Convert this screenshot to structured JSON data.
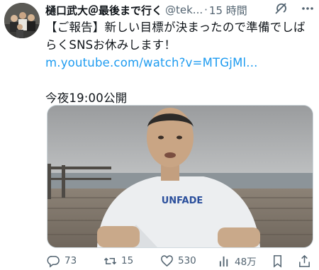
{
  "author": {
    "name": "樋口武大＠最後まで行く",
    "handle": "@tek...",
    "separator": "·",
    "time": "15 時間"
  },
  "tweet": {
    "line1": "【ご報告】新しい目標が決まったので準備でしば",
    "line2": "らくSNSお休みします！",
    "link": "m.youtube.com/watch?v=MTGjMl...",
    "line4": "今夜19:00公開"
  },
  "media": {
    "shirt_text": "UNFADE"
  },
  "actions": {
    "reply_count": "73",
    "retweet_count": "15",
    "like_count": "530",
    "views_count": "48万"
  },
  "icons": {
    "grok": "grok-icon",
    "more": "more-icon",
    "reply": "reply-icon",
    "retweet": "retweet-icon",
    "like": "heart-icon",
    "views": "views-icon",
    "bookmark": "bookmark-icon",
    "share": "share-icon"
  },
  "colors": {
    "text": "#0f1419",
    "secondary": "#536471",
    "link": "#1d9bf0"
  }
}
